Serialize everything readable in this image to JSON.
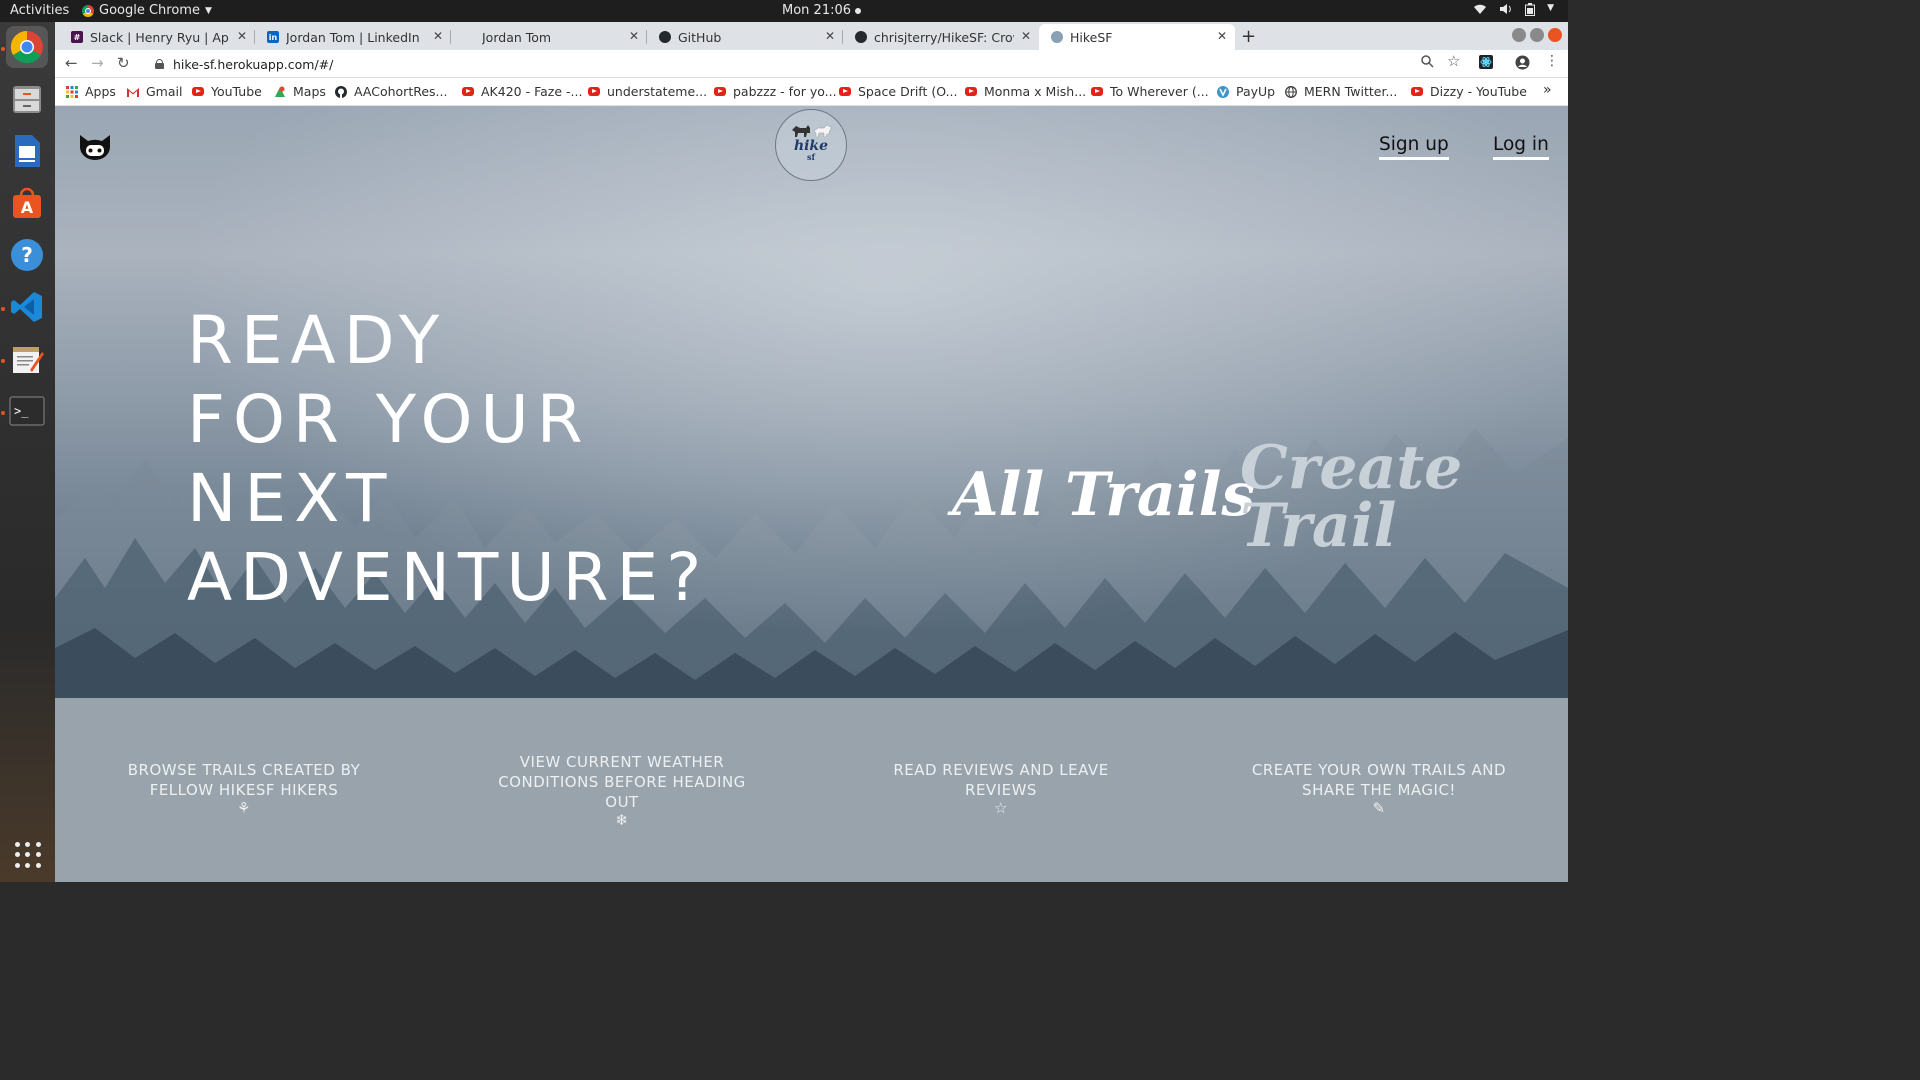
{
  "system": {
    "activities": "Activities",
    "app_name": "Google Chrome",
    "clock": "Mon 21:06"
  },
  "browser": {
    "tabs": [
      {
        "label": "Slack | Henry Ryu | App Academy",
        "favicon_color": "#4a154b"
      },
      {
        "label": "Jordan Tom | LinkedIn",
        "favicon_color": "#0a66c2"
      },
      {
        "label": "Jordan Tom",
        "favicon_color": "#dee1e6"
      },
      {
        "label": "GitHub",
        "favicon_color": "#24292e"
      },
      {
        "label": "chrisjterry/HikeSF: Crowdsourced",
        "favicon_color": "#24292e"
      },
      {
        "label": "HikeSF",
        "favicon_color": "#8aa0b4",
        "active": true
      }
    ],
    "url": "hike-sf.herokuapp.com/#/",
    "bookmarks": [
      {
        "label": "Apps",
        "icon": "apps-grid-icon"
      },
      {
        "label": "Gmail",
        "icon": "gmail-icon"
      },
      {
        "label": "YouTube",
        "icon": "youtube-icon"
      },
      {
        "label": "Maps",
        "icon": "maps-icon"
      },
      {
        "label": "AACohortRes...",
        "icon": "github-icon"
      },
      {
        "label": "AK420 - Faze -...",
        "icon": "youtube-icon"
      },
      {
        "label": "understateme...",
        "icon": "youtube-icon"
      },
      {
        "label": "pabzzz - for yo...",
        "icon": "youtube-icon"
      },
      {
        "label": "Space Drift (O...",
        "icon": "youtube-icon"
      },
      {
        "label": "Monma x Mish...",
        "icon": "youtube-icon"
      },
      {
        "label": "To Wherever (...",
        "icon": "youtube-icon"
      },
      {
        "label": "PayUp",
        "icon": "payup-icon"
      },
      {
        "label": "MERN Twitter...",
        "icon": "globe-icon"
      },
      {
        "label": "Dizzy - YouTube",
        "icon": "youtube-icon"
      }
    ],
    "overflow": "»"
  },
  "site": {
    "logo_text": "hike",
    "logo_subtext": "sf",
    "nav": {
      "signup": "Sign up",
      "login": "Log in"
    },
    "headline": [
      "READY",
      "FOR YOUR",
      "NEXT",
      "ADVENTURE?"
    ],
    "cta": {
      "all_trails": "All Trails",
      "create_trail_1": "Create",
      "create_trail_2": "Trail"
    },
    "features": [
      {
        "text": "BROWSE TRAILS CREATED BY FELLOW HIKESF HIKERS",
        "icon_glyph": "⚘",
        "icon": "flower-icon"
      },
      {
        "text": "VIEW CURRENT WEATHER CONDITIONS BEFORE HEADING OUT",
        "icon_glyph": "❄",
        "icon": "snowflake-icon"
      },
      {
        "text": "READ REVIEWS AND LEAVE REVIEWS",
        "icon_glyph": "☆",
        "icon": "star-icon"
      },
      {
        "text": "CREATE YOUR OWN TRAILS AND SHARE THE MAGIC!",
        "icon_glyph": "✎",
        "icon": "pencil-icon"
      }
    ]
  }
}
